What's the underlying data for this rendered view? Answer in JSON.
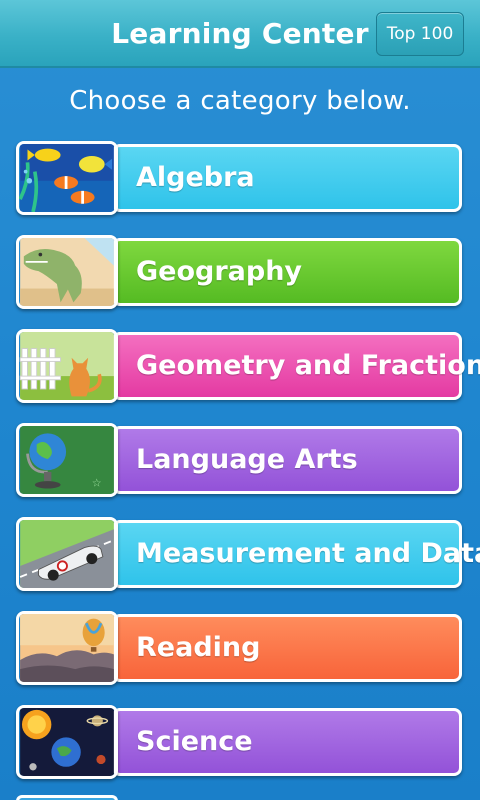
{
  "header": {
    "title": "Learning Center",
    "top_button": "Top 100"
  },
  "subtitle": "Choose a category below.",
  "categories": [
    {
      "label": "Algebra",
      "color": "#3cc9ee",
      "thumb": "fish-icon"
    },
    {
      "label": "Geography",
      "color": "#66c82d",
      "thumb": "dinosaur-icon"
    },
    {
      "label": "Geometry and Fractions",
      "color": "#ea4daf",
      "thumb": "cat-fence-icon"
    },
    {
      "label": "Language Arts",
      "color": "#a065e0",
      "thumb": "globe-icon"
    },
    {
      "label": "Measurement and Data",
      "color": "#3cc9ee",
      "thumb": "race-car-icon"
    },
    {
      "label": "Reading",
      "color": "#fa7448",
      "thumb": "hot-air-balloon-icon"
    },
    {
      "label": "Science",
      "color": "#a065e0",
      "thumb": "planets-icon"
    }
  ]
}
